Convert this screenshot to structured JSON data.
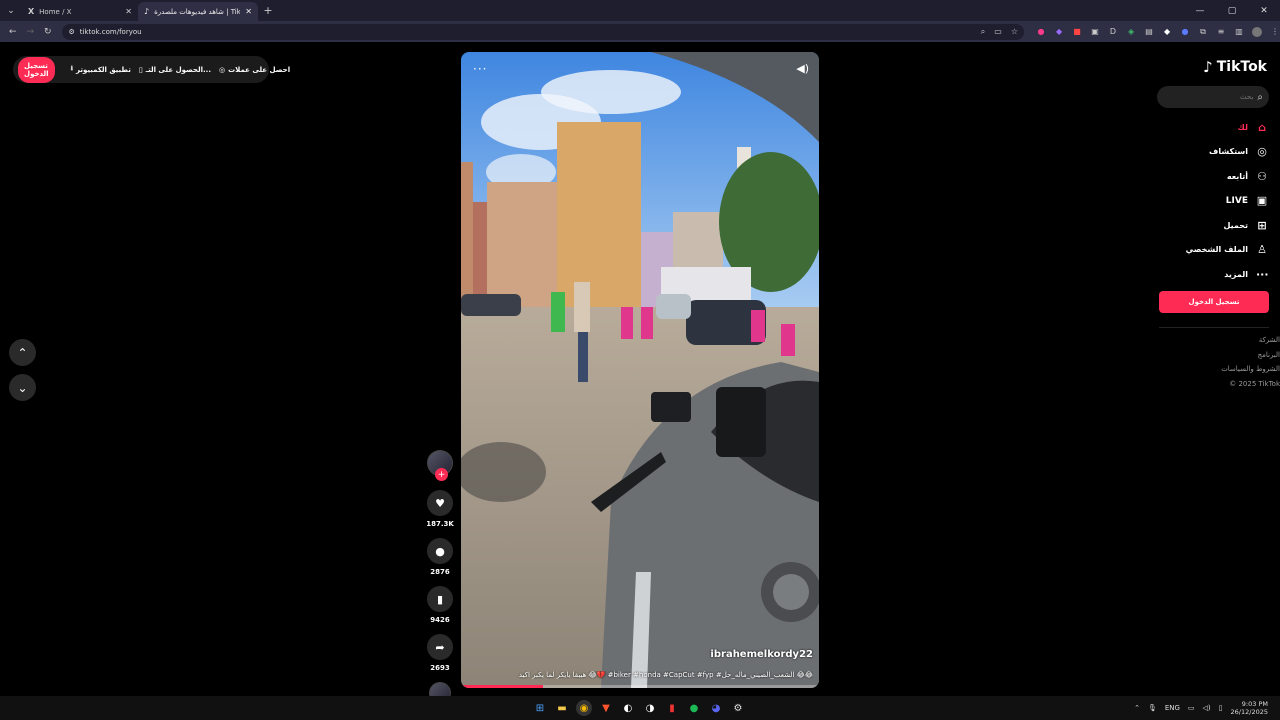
{
  "browser": {
    "tabs": [
      {
        "icon": "X",
        "title": "Home / X",
        "active": false
      },
      {
        "icon": "♪",
        "title": "شاهد فيديوهات ملصدرة | Tik...",
        "active": true
      }
    ],
    "url": "tiktok.com/foryou"
  },
  "topbar": {
    "login_label": "تسجيل الدخول",
    "items": [
      {
        "label": "تطبيق الكمبيوتر",
        "icon": "download-icon"
      },
      {
        "label": "الحصول على التـ...",
        "icon": "phone-icon"
      },
      {
        "label": "احصل على عملات",
        "icon": "coin-icon"
      }
    ]
  },
  "sidebar": {
    "logo": "TikTok",
    "search_placeholder": "بحث",
    "items": [
      {
        "label": "لك",
        "icon": "home-icon",
        "active": true
      },
      {
        "label": "استكشاف",
        "icon": "compass-icon",
        "active": false
      },
      {
        "label": "أتابعه",
        "icon": "user-follow-icon",
        "active": false
      },
      {
        "label": "LIVE",
        "icon": "live-icon",
        "active": false
      },
      {
        "label": "تحميل",
        "icon": "upload-icon",
        "active": false
      },
      {
        "label": "الملف الشخصي",
        "icon": "profile-icon",
        "active": false
      },
      {
        "label": "المزيد",
        "icon": "more-icon",
        "active": false
      }
    ],
    "login_label": "تسجيل الدخول",
    "footer": [
      "الشركة",
      "البرنامج",
      "الشروط والسياسات",
      "© 2025 TikTok"
    ]
  },
  "video": {
    "author": "ibrahemelkordy22",
    "caption": "هيبقا بايكر لما يكبر اكيد 😂💔 #biker #honda #CapCut #fyp #الشعب_الصيني_ماله_حل 😂😂",
    "progress": 0.23
  },
  "actions": {
    "likes": "187.3K",
    "comments": "2876",
    "saves": "9426",
    "shares": "2693"
  },
  "taskbar": {
    "lang": "ENG",
    "time": "9:03 PM",
    "date": "26/12/2025"
  }
}
